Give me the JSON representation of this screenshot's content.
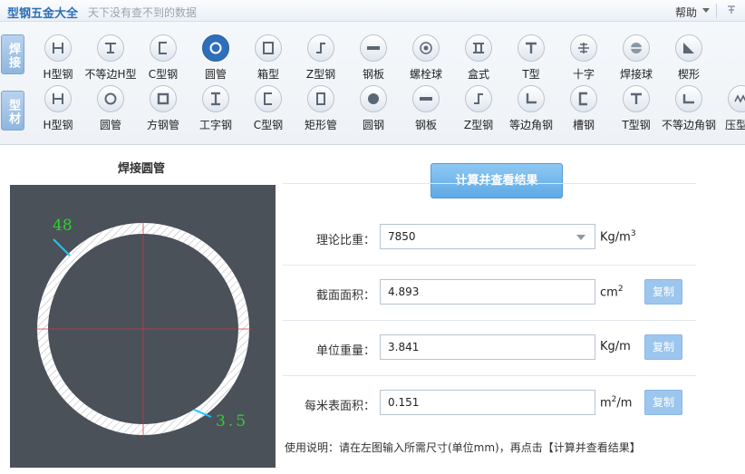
{
  "header": {
    "app_title": "型钢五金大全",
    "slogan": "天下没有查不到的数据",
    "help_label": "帮助",
    "help_caret_icon": "caret-down-icon",
    "pin_icon": "pin-icon"
  },
  "toolbar": {
    "weld_category": "焊接",
    "profile_category": "型材",
    "weld_tools": [
      {
        "label": "H型钢",
        "icon": "h-beam-icon"
      },
      {
        "label": "不等边H型",
        "icon": "unequal-h-icon"
      },
      {
        "label": "C型钢",
        "icon": "c-channel-icon"
      },
      {
        "label": "圆管",
        "icon": "round-tube-icon",
        "active": true
      },
      {
        "label": "箱型",
        "icon": "box-section-icon"
      },
      {
        "label": "Z型钢",
        "icon": "z-section-icon"
      },
      {
        "label": "钢板",
        "icon": "plate-icon"
      },
      {
        "label": "螺栓球",
        "icon": "bolt-ball-icon"
      },
      {
        "label": "盒式",
        "icon": "box-type-icon"
      },
      {
        "label": "T型",
        "icon": "t-section-icon"
      },
      {
        "label": "十字",
        "icon": "cross-section-icon"
      },
      {
        "label": "焊接球",
        "icon": "welded-ball-icon"
      },
      {
        "label": "楔形",
        "icon": "wedge-icon"
      }
    ],
    "profile_tools": [
      {
        "label": "H型钢",
        "icon": "h-beam-icon"
      },
      {
        "label": "圆管",
        "icon": "round-tube-icon"
      },
      {
        "label": "方钢管",
        "icon": "square-tube-icon"
      },
      {
        "label": "工字钢",
        "icon": "i-beam-icon"
      },
      {
        "label": "C型钢",
        "icon": "c-channel-icon"
      },
      {
        "label": "矩形管",
        "icon": "rect-tube-icon"
      },
      {
        "label": "圆钢",
        "icon": "round-bar-icon"
      },
      {
        "label": "钢板",
        "icon": "plate-icon"
      },
      {
        "label": "Z型钢",
        "icon": "z-section-icon"
      },
      {
        "label": "等边角钢",
        "icon": "equal-angle-icon"
      },
      {
        "label": "槽钢",
        "icon": "channel-icon"
      },
      {
        "label": "T型钢",
        "icon": "t-section-icon"
      },
      {
        "label": "不等边角钢",
        "icon": "unequal-angle-icon"
      },
      {
        "label": "压型钢",
        "icon": "profiled-sheet-icon"
      }
    ]
  },
  "diagram": {
    "title": "焊接圆管",
    "diameter": "48",
    "thickness": "3.5",
    "dimension_color": "#2ed12e"
  },
  "calculator": {
    "calc_button": "计算并查看结果",
    "density_label": "理论比重：",
    "density_value": "7850",
    "density_unit": "Kg/m",
    "density_unit_exp": "3",
    "area_label": "截面面积：",
    "area_value": "4.893",
    "area_unit": "cm",
    "area_unit_exp": "2",
    "weight_label": "单位重量：",
    "weight_value": "3.841",
    "weight_unit": "Kg/m",
    "surface_label": "每米表面积：",
    "surface_value": "0.151",
    "surface_unit_pre": "m",
    "surface_unit_exp": "2",
    "surface_unit_post": "/m",
    "copy_label": "复制",
    "usage_text": "使用说明：请在左图输入所需尺寸(单位mm)，再点击【计算并查看结果】"
  },
  "colors": {
    "accent": "#2f6fba",
    "diagram_bg": "#4b5159",
    "button": "#6fb3ea"
  }
}
